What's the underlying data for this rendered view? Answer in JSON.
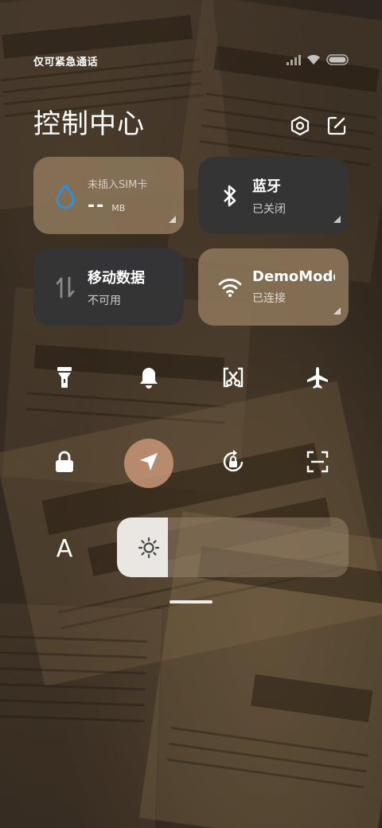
{
  "status_bar": {
    "carrier_text": "仅可紧急通话",
    "icons": [
      "signal-icon",
      "wifi-icon",
      "battery-icon"
    ]
  },
  "header": {
    "title": "控制中心",
    "settings_icon": "settings-hex-icon",
    "edit_icon": "edit-icon"
  },
  "tiles": {
    "sim": {
      "label": "未插入SIM卡",
      "value": "--",
      "unit": "MB",
      "icon": "water-drop-icon"
    },
    "bluetooth": {
      "label": "蓝牙",
      "status": "已关闭",
      "icon": "bluetooth-icon"
    },
    "mobile_data": {
      "label": "移动数据",
      "status": "不可用",
      "icon": "data-arrows-icon"
    },
    "wifi": {
      "label": "DemoMode",
      "status": "已连接",
      "icon": "wifi-icon"
    }
  },
  "toggles": [
    {
      "name": "flashlight",
      "icon": "flashlight-icon",
      "active": false
    },
    {
      "name": "silent",
      "icon": "bell-icon",
      "active": false
    },
    {
      "name": "screenshot",
      "icon": "screenshot-scissors-icon",
      "active": false
    },
    {
      "name": "airplane",
      "icon": "airplane-icon",
      "active": false
    },
    {
      "name": "lock",
      "icon": "lock-icon",
      "active": false
    },
    {
      "name": "location",
      "icon": "location-arrow-icon",
      "active": true
    },
    {
      "name": "auto-rotate",
      "icon": "rotate-lock-icon",
      "active": false
    },
    {
      "name": "scanner",
      "icon": "scan-icon",
      "active": false
    }
  ],
  "brightness": {
    "font_button": "A",
    "level": 0.22,
    "icon": "sun-icon"
  },
  "colors": {
    "tile_brown": "#8c765a",
    "tile_gray": "#343436",
    "accent_blue": "#2f8fe0",
    "location_active": "#c89678"
  }
}
